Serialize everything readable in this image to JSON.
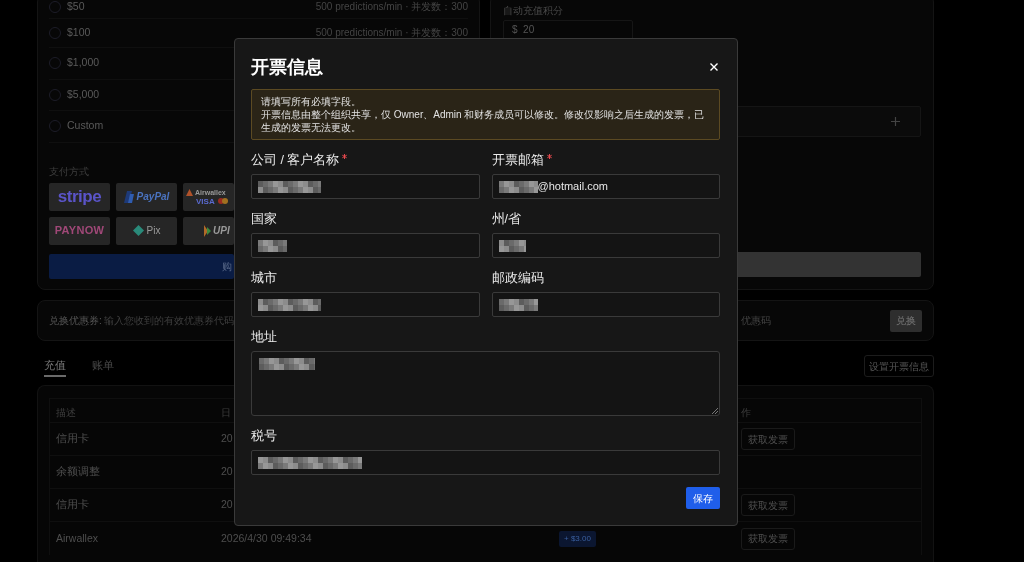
{
  "plans": {
    "options": [
      {
        "label": "$50",
        "selected": false,
        "note": "500 predictions/min · 并发数：300"
      },
      {
        "label": "$100",
        "selected": false,
        "note": "500 predictions/min · 并发数：300"
      },
      {
        "label": "$1,000",
        "selected": false
      },
      {
        "label": "$5,000",
        "selected": false
      },
      {
        "label": "Custom",
        "selected": false
      }
    ]
  },
  "payment": {
    "label": "支付方式",
    "methods": [
      {
        "kind": "stripe",
        "label": "stripe"
      },
      {
        "kind": "paypal",
        "label": "PayPal"
      },
      {
        "kind": "airwallex",
        "label": "Airwallex",
        "sublabel": "VISA"
      },
      {
        "kind": "paynow",
        "label": "PAYNOW"
      },
      {
        "kind": "pix",
        "label": "Pix"
      },
      {
        "kind": "upi",
        "label": "UPI"
      }
    ],
    "button": "购"
  },
  "auto_topup": {
    "label": "自动充值积分",
    "currency": "$",
    "value": "20"
  },
  "coupon": {
    "label": "兑换优惠券:",
    "hint": "输入您收到的有效优惠券代码",
    "placeholder": "优惠码",
    "button": "兑换"
  },
  "tabs": [
    {
      "label": "充值",
      "selected": true
    },
    {
      "label": "账单",
      "selected": false
    }
  ],
  "invoice_settings_button": "设置开票信息",
  "table": {
    "header": {
      "column_1": "描述",
      "column_2": "日",
      "column_4": "作"
    },
    "rows": [
      {
        "column_1": "信用卡",
        "column_2": "20",
        "column_4": "获取发票"
      },
      {
        "column_1": "余额调整",
        "column_2": "20"
      },
      {
        "column_1": "信用卡",
        "column_2": "20",
        "column_4": "获取发票"
      },
      {
        "column_1": "Airwallex",
        "column_2": "2026/4/30 09:49:34",
        "column_3": "+ $3.00",
        "column_4": "获取发票"
      }
    ]
  },
  "dialog": {
    "title": "开票信息",
    "notice": [
      "请填写所有必填字段。",
      "开票信息由整个组织共享，仅 Owner、Admin 和财务成员可以修改。修改仅影响之后生成的发票，已生成的发票无法更改。"
    ],
    "rows": [
      [
        {
          "label": "公司 / 客户名称",
          "required": true,
          "kind": "input",
          "blurred": true
        },
        {
          "label": "开票邮箱",
          "required": true,
          "kind": "input",
          "blurred": true,
          "value": "@hotmail.com"
        }
      ],
      [
        {
          "label": "国家",
          "required": false,
          "kind": "input",
          "blurred": true
        },
        {
          "label": "州/省",
          "required": false,
          "kind": "input",
          "blurred": true
        }
      ],
      [
        {
          "label": "城市",
          "required": false,
          "kind": "input",
          "blurred": true
        },
        {
          "label": "邮政编码",
          "required": false,
          "kind": "input",
          "blurred": true
        }
      ],
      [
        {
          "label": "地址",
          "required": false,
          "kind": "textarea",
          "blurred": true
        }
      ],
      [
        {
          "label": "税号",
          "required": false,
          "kind": "input",
          "blurred": true
        }
      ]
    ],
    "save_button": "保存"
  }
}
